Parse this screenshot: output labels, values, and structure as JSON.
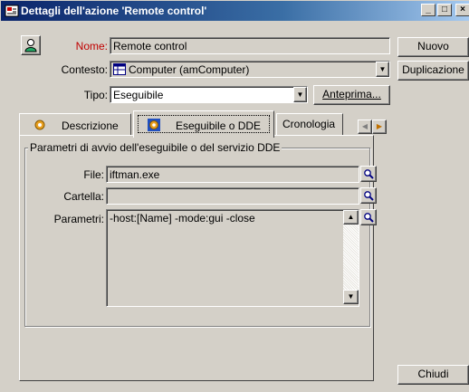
{
  "window": {
    "title": "Dettagli dell'azione 'Remote control'",
    "controls": {
      "minimize": "_",
      "maximize": "□",
      "close": "×"
    }
  },
  "form": {
    "nome_label": "Nome:",
    "nome_value": "Remote control",
    "contesto_label": "Contesto:",
    "contesto_value": "Computer (amComputer)",
    "tipo_label": "Tipo:",
    "tipo_value": "Eseguibile",
    "anteprima_button": "Anteprima..."
  },
  "buttons": {
    "nuovo": "Nuovo",
    "duplicazione": "Duplicazione",
    "chiudi": "Chiudi"
  },
  "tabs": [
    {
      "label": "Descrizione"
    },
    {
      "label": "Eseguibile o DDE"
    },
    {
      "label": "Cronologia"
    }
  ],
  "group": {
    "title": "Parametri di avvio dell'eseguibile o del servizio DDE",
    "file_label": "File:",
    "file_value": "iftman.exe",
    "cartella_label": "Cartella:",
    "cartella_value": "",
    "parametri_label": "Parametri:",
    "parametri_value": "-host:[Name] -mode:gui -close"
  },
  "icons": {
    "window": "action-icon",
    "record": "user-icon",
    "contesto": "table-icon",
    "zoom": "magnifier-icon",
    "tab_descrizione": "gear-icon",
    "tab_eseguibile": "gear-icon"
  }
}
